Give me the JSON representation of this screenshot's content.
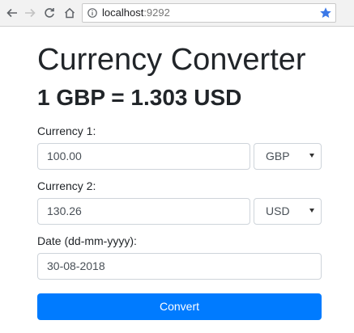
{
  "browser": {
    "url_host": "localhost",
    "url_port": ":9292",
    "icons": [
      "back-arrow-icon",
      "forward-arrow-icon",
      "reload-icon",
      "home-icon",
      "info-icon",
      "star-icon"
    ]
  },
  "page": {
    "title": "Currency Converter",
    "rate_text": "1 GBP = 1.303 USD",
    "currency1": {
      "label": "Currency 1:",
      "amount": "100.00",
      "currency": "GBP"
    },
    "currency2": {
      "label": "Currency 2:",
      "amount": "130.26",
      "currency": "USD"
    },
    "date": {
      "label": "Date (dd-mm-yyyy):",
      "value": "30-08-2018"
    },
    "convert_label": "Convert"
  },
  "colors": {
    "primary_button": "#007bff",
    "bookmark_star": "#3b78e7"
  }
}
